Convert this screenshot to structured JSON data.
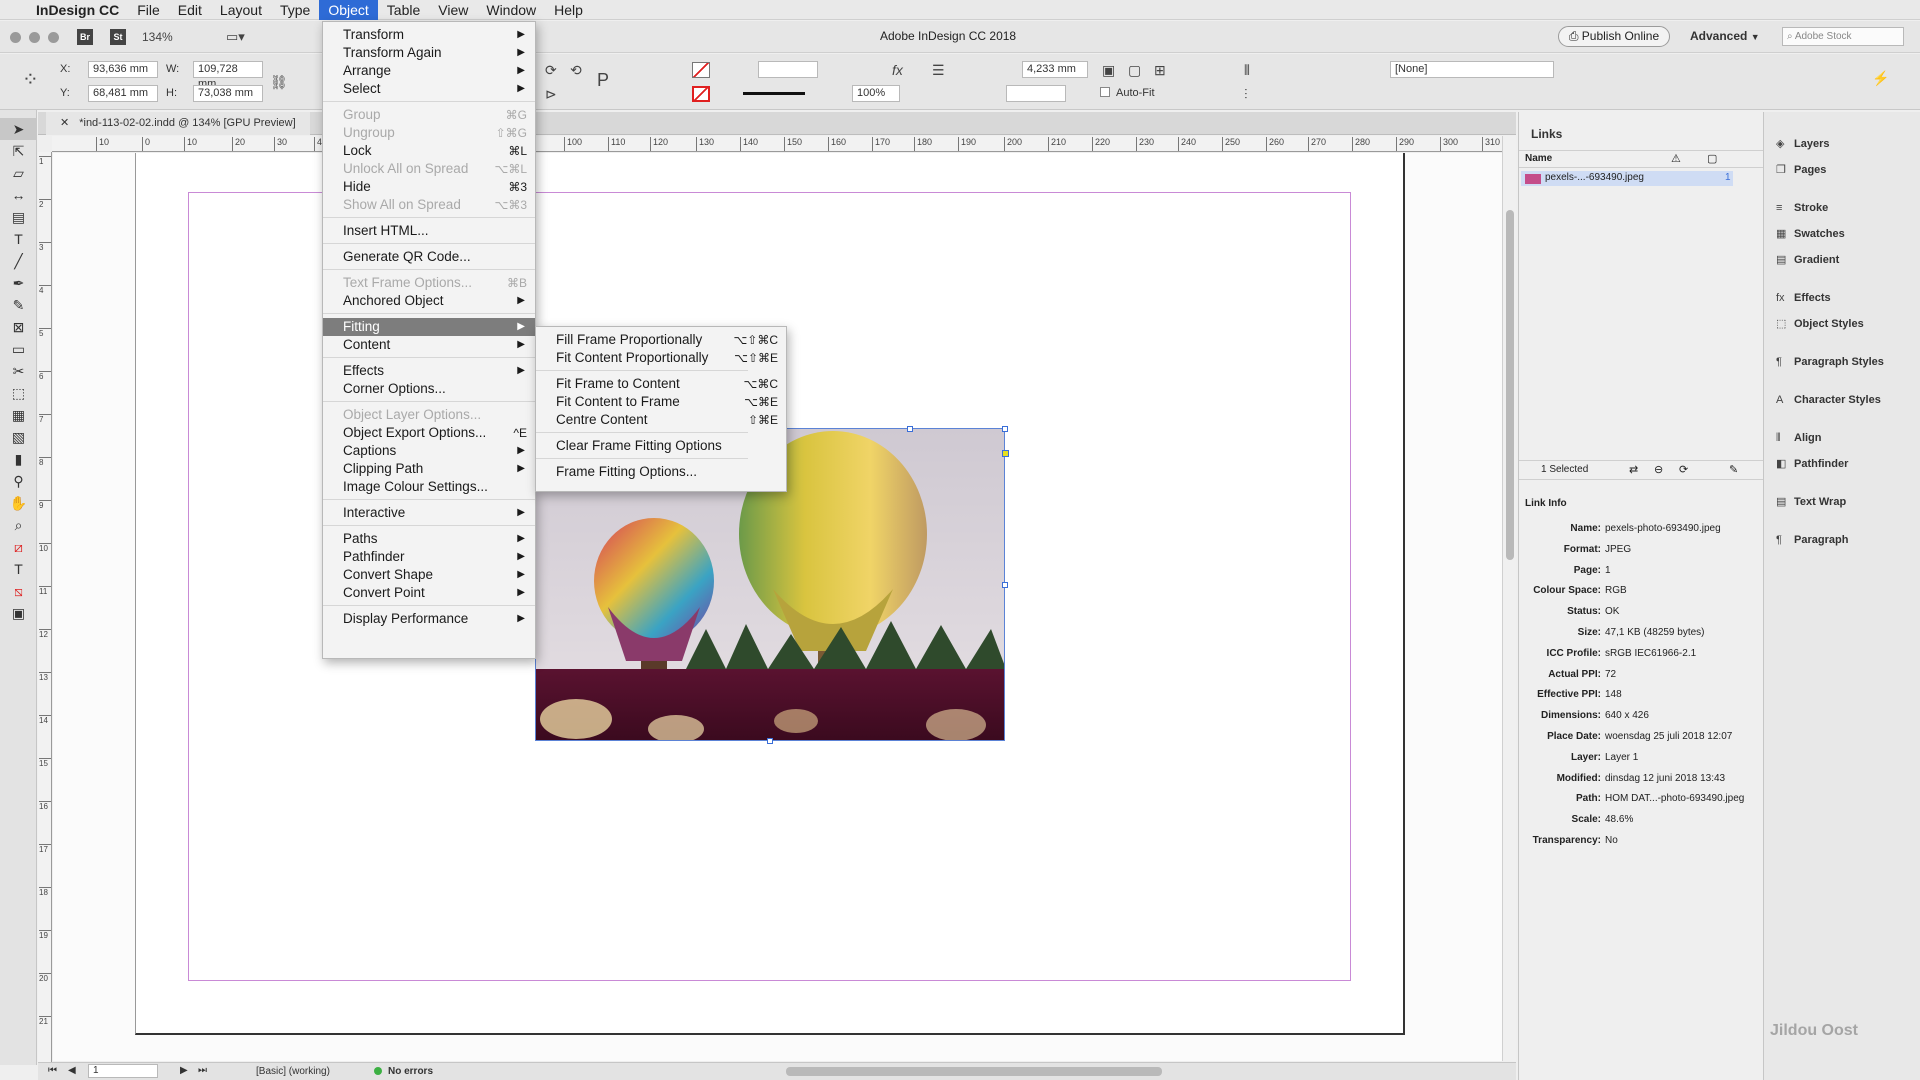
{
  "menubar": {
    "apple": "",
    "app": "InDesign CC",
    "items": [
      "File",
      "Edit",
      "Layout",
      "Type",
      "Object",
      "Table",
      "View",
      "Window",
      "Help"
    ]
  },
  "appbar": {
    "title": "Adobe InDesign CC 2018",
    "zoom": "134%",
    "publish": "Publish Online",
    "workspace": "Advanced",
    "stock": "Adobe Stock",
    "br": "Br",
    "st": "St"
  },
  "controls": {
    "x": "93,636 mm",
    "y": "68,481 mm",
    "w": "109,728 mm",
    "h": "73,038 mm",
    "stroke": "4,233 mm",
    "opacity": "100%",
    "style": "[None]",
    "autofit": "Auto-Fit",
    "x_label": "X:",
    "y_label": "Y:",
    "w_label": "W:",
    "h_label": "H:"
  },
  "document": {
    "tab": "*ind-113-02-02.indd @ 134% [GPU Preview]"
  },
  "ruler": {
    "h": [
      "10",
      "0",
      "10",
      "20",
      "30",
      "40",
      "100",
      "110",
      "120",
      "130",
      "140",
      "150",
      "160",
      "170",
      "180",
      "190",
      "200",
      "210",
      "220",
      "230",
      "240",
      "250",
      "260",
      "270",
      "280",
      "290",
      "300",
      "310"
    ],
    "v": [
      "1",
      "2",
      "3",
      "4",
      "5",
      "6",
      "7",
      "8",
      "9",
      "10",
      "11",
      "12",
      "13",
      "14",
      "15",
      "16",
      "17",
      "18",
      "19",
      "20",
      "21"
    ]
  },
  "status": {
    "page": "1",
    "style": "[Basic] (working)",
    "errors": "No errors"
  },
  "object_menu": [
    {
      "label": "Transform",
      "sub": true
    },
    {
      "label": "Transform Again",
      "sub": true
    },
    {
      "label": "Arrange",
      "sub": true
    },
    {
      "label": "Select",
      "sub": true
    },
    {
      "sep": true
    },
    {
      "label": "Group",
      "shortcut": "⌘G",
      "disabled": true
    },
    {
      "label": "Ungroup",
      "shortcut": "⇧⌘G",
      "disabled": true
    },
    {
      "label": "Lock",
      "shortcut": "⌘L"
    },
    {
      "label": "Unlock All on Spread",
      "shortcut": "⌥⌘L",
      "disabled": true
    },
    {
      "label": "Hide",
      "shortcut": "⌘3"
    },
    {
      "label": "Show All on Spread",
      "shortcut": "⌥⌘3",
      "disabled": true
    },
    {
      "sep": true
    },
    {
      "label": "Insert HTML..."
    },
    {
      "sep": true
    },
    {
      "label": "Generate QR Code..."
    },
    {
      "sep": true
    },
    {
      "label": "Text Frame Options...",
      "shortcut": "⌘B",
      "disabled": true
    },
    {
      "label": "Anchored Object",
      "sub": true
    },
    {
      "sep": true
    },
    {
      "label": "Fitting",
      "sub": true,
      "highlight": true
    },
    {
      "label": "Content",
      "sub": true
    },
    {
      "sep": true
    },
    {
      "label": "Effects",
      "sub": true
    },
    {
      "label": "Corner Options..."
    },
    {
      "sep": true
    },
    {
      "label": "Object Layer Options...",
      "disabled": true
    },
    {
      "label": "Object Export Options...",
      "shortcut": "^E"
    },
    {
      "label": "Captions",
      "sub": true
    },
    {
      "label": "Clipping Path",
      "sub": true
    },
    {
      "label": "Image Colour Settings..."
    },
    {
      "sep": true
    },
    {
      "label": "Interactive",
      "sub": true
    },
    {
      "sep": true
    },
    {
      "label": "Paths",
      "sub": true
    },
    {
      "label": "Pathfinder",
      "sub": true
    },
    {
      "label": "Convert Shape",
      "sub": true
    },
    {
      "label": "Convert Point",
      "sub": true
    },
    {
      "sep": true
    },
    {
      "label": "Display Performance",
      "sub": true
    }
  ],
  "fitting_menu": [
    {
      "label": "Fill Frame Proportionally",
      "shortcut": "⌥⇧⌘C"
    },
    {
      "label": "Fit Content Proportionally",
      "shortcut": "⌥⇧⌘E"
    },
    {
      "sep": true
    },
    {
      "label": "Fit Frame to Content",
      "shortcut": "⌥⌘C"
    },
    {
      "label": "Fit Content to Frame",
      "shortcut": "⌥⌘E"
    },
    {
      "label": "Centre Content",
      "shortcut": "⇧⌘E"
    },
    {
      "sep": true
    },
    {
      "label": "Clear Frame Fitting Options"
    },
    {
      "sep": true
    },
    {
      "label": "Frame Fitting Options..."
    }
  ],
  "links": {
    "tab": "Links",
    "col_name": "Name",
    "file": "pexels-...-693490.jpeg",
    "page": "1",
    "selected": "1 Selected",
    "info_title": "Link Info",
    "info": [
      {
        "k": "Name:",
        "v": "pexels-photo-693490.jpeg"
      },
      {
        "k": "Format:",
        "v": "JPEG"
      },
      {
        "k": "Page:",
        "v": "1"
      },
      {
        "k": "Colour Space:",
        "v": "RGB"
      },
      {
        "k": "Status:",
        "v": "OK"
      },
      {
        "k": "Size:",
        "v": "47,1 KB (48259 bytes)"
      },
      {
        "k": "ICC Profile:",
        "v": "sRGB IEC61966-2.1"
      },
      {
        "k": "Actual PPI:",
        "v": "72"
      },
      {
        "k": "Effective PPI:",
        "v": "148"
      },
      {
        "k": "Dimensions:",
        "v": "640 x 426"
      },
      {
        "k": "Place Date:",
        "v": "woensdag 25 juli 2018 12:07"
      },
      {
        "k": "Layer:",
        "v": "Layer 1"
      },
      {
        "k": "Modified:",
        "v": "dinsdag 12 juni 2018 13:43"
      },
      {
        "k": "Path:",
        "v": "HOM DAT...-photo-693490.jpeg"
      },
      {
        "k": "Scale:",
        "v": "48.6%"
      },
      {
        "k": "Transparency:",
        "v": "No"
      }
    ]
  },
  "dock": [
    {
      "label": "Layers",
      "icon": "layers-icon"
    },
    {
      "label": "Pages",
      "icon": "pages-icon"
    },
    {
      "label": "Stroke",
      "icon": "stroke-icon"
    },
    {
      "label": "Swatches",
      "icon": "swatches-icon"
    },
    {
      "label": "Gradient",
      "icon": "gradient-icon"
    },
    {
      "label": "Effects",
      "icon": "effects-icon"
    },
    {
      "label": "Object Styles",
      "icon": "object-styles-icon"
    },
    {
      "label": "Paragraph Styles",
      "icon": "paragraph-styles-icon"
    },
    {
      "label": "Character Styles",
      "icon": "character-styles-icon"
    },
    {
      "label": "Align",
      "icon": "align-icon"
    },
    {
      "label": "Pathfinder",
      "icon": "pathfinder-icon"
    },
    {
      "label": "Text Wrap",
      "icon": "text-wrap-icon"
    },
    {
      "label": "Paragraph",
      "icon": "paragraph-icon"
    }
  ],
  "watermark": "Jildou Oost"
}
